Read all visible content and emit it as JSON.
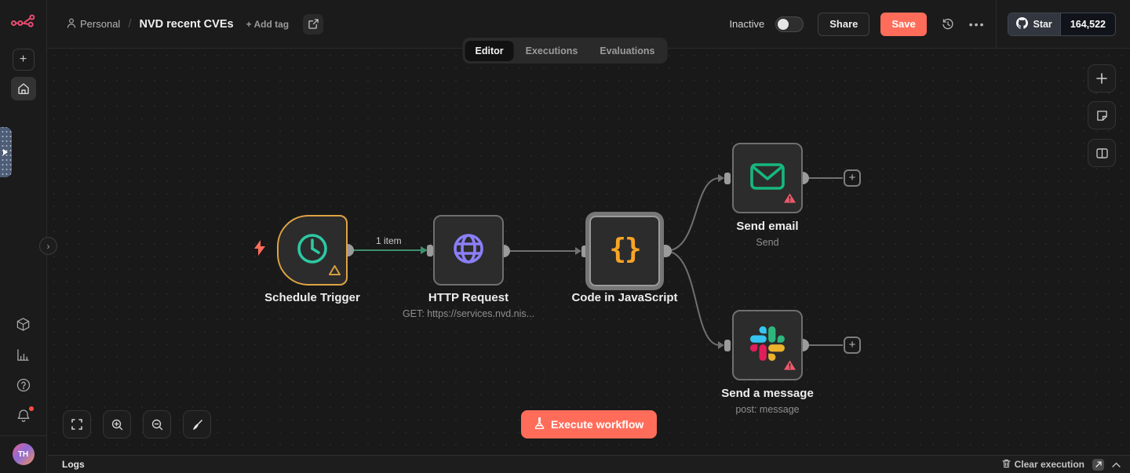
{
  "header": {
    "project": "Personal",
    "workflow_title": "NVD recent CVEs",
    "add_tag": "+ Add tag",
    "activation_status": "Inactive",
    "share": "Share",
    "save": "Save",
    "menu_dots": "...",
    "github_star": "Star",
    "github_count": "164,522"
  },
  "tabs": {
    "editor": "Editor",
    "executions": "Executions",
    "evaluations": "Evaluations"
  },
  "sidebar": {
    "avatar_initials": "TH",
    "add_plus": "+"
  },
  "canvas": {
    "connection_label": "1 item",
    "execute_button": "Execute workflow",
    "plus": "+",
    "chevron": "›",
    "nodes": [
      {
        "label": "Schedule Trigger",
        "subtitle": ""
      },
      {
        "label": "HTTP Request",
        "subtitle": "GET: https://services.nvd.nis..."
      },
      {
        "label": "Code in JavaScript",
        "subtitle": ""
      },
      {
        "label": "Send email",
        "subtitle": "Send"
      },
      {
        "label": "Send a message",
        "subtitle": "post: message"
      }
    ]
  },
  "logs": {
    "title": "Logs",
    "clear": "Clear execution"
  },
  "colors": {
    "accent": "#ff6d5a",
    "trigger_border": "#dfa343",
    "success_line": "#3f8f6d",
    "node_border": "#6f6f6f",
    "schedule_icon": "#2dc9a2",
    "http_icon": "#8b7ff7",
    "code_icon": "#f7a426",
    "email_icon": "#16b87f",
    "warning_red": "#f0596b",
    "warning_orange": "#d79b3f",
    "slack_blue": "#36C5F0",
    "slack_green": "#2EB67D",
    "slack_yellow": "#ECB22E",
    "slack_red": "#E01E5A",
    "brand_pink": "#EA4B71"
  }
}
